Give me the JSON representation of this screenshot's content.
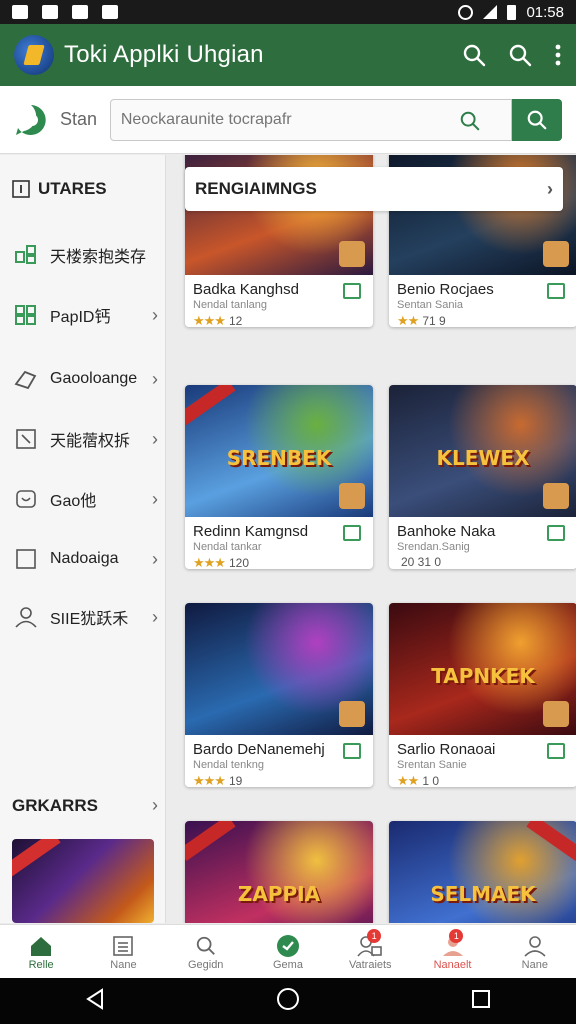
{
  "status_bar": {
    "time": "01:58"
  },
  "app_bar": {
    "title": "Toki Applki Uhgian"
  },
  "search": {
    "label": "Stan",
    "placeholder": "Neockaraunite tocrapafr"
  },
  "sidebar": {
    "header": "UTARES",
    "items": [
      {
        "label": "天楼索抱类存",
        "icon": "grid-icon"
      },
      {
        "label": "PapID钙",
        "icon": "apps-icon"
      },
      {
        "label": "Gaooloange",
        "icon": "gamepad-icon"
      },
      {
        "label": "天能蓿权拆",
        "icon": "frame-icon"
      },
      {
        "label": "Gao他",
        "icon": "controller-icon"
      },
      {
        "label": "Nadoaiga",
        "icon": "tablet-icon"
      },
      {
        "label": "SIIE犹跃禾",
        "icon": "user-icon"
      }
    ],
    "sub_header": "GRKARRS"
  },
  "panel": {
    "section_title": "RENGIAIMNGS"
  },
  "games": [
    {
      "name": "Badka Kanghsd",
      "dev": "Nendal tanlang",
      "rating": "12",
      "stars": "★★★",
      "art_text": "",
      "colors": [
        "#2b1a40",
        "#c8562a",
        "#f2b23a"
      ]
    },
    {
      "name": "Benio Rocjaes",
      "dev": "Sentan Sania",
      "rating": "71 9",
      "stars": "★★",
      "art_text": "",
      "colors": [
        "#0c1424",
        "#24405e",
        "#d87a2a"
      ]
    },
    {
      "name": "Redinn Kamgnsd",
      "dev": "Nendal tankar",
      "rating": "120",
      "stars": "★★★",
      "art_text": "SRENBEK",
      "colors": [
        "#1a3a7a",
        "#5aa0e0",
        "#6ab040"
      ]
    },
    {
      "name": "Banhoke Naka",
      "dev": "Srendan.Sanig",
      "rating": "20 31 0",
      "stars": "",
      "art_text": "KLEWEX",
      "colors": [
        "#1b2238",
        "#3a4e7a",
        "#c86a30"
      ]
    },
    {
      "name": "Bardo DeNanemehj",
      "dev": "Nendal tenkng",
      "rating": "19",
      "stars": "★★★",
      "art_text": "",
      "colors": [
        "#101a40",
        "#2a6ab0",
        "#b040c0"
      ]
    },
    {
      "name": "Sarlio Ronaoai",
      "dev": "Srentan Sanie",
      "rating": "1 0",
      "stars": "★★",
      "art_text": "TAPNKEK",
      "colors": [
        "#3a0a10",
        "#a8281c",
        "#f0a030"
      ]
    },
    {
      "name": "",
      "dev": "",
      "rating": "",
      "stars": "",
      "art_text": "ZAPPIA",
      "colors": [
        "#3a1050",
        "#c03060",
        "#f0c040"
      ]
    },
    {
      "name": "",
      "dev": "",
      "rating": "",
      "stars": "",
      "art_text": "SELMAEK",
      "colors": [
        "#1a2a70",
        "#4070d0",
        "#e0a030"
      ]
    }
  ],
  "bottom_nav": [
    {
      "label": "Relle",
      "icon": "home-icon",
      "state": "active",
      "badge": ""
    },
    {
      "label": "Nane",
      "icon": "list-icon",
      "state": "",
      "badge": ""
    },
    {
      "label": "Gegidn",
      "icon": "search-icon",
      "state": "",
      "badge": ""
    },
    {
      "label": "Gema",
      "icon": "game-icon",
      "state": "",
      "badge": ""
    },
    {
      "label": "Vatraiets",
      "icon": "people-icon",
      "state": "",
      "badge": "1"
    },
    {
      "label": "Nanaelt",
      "icon": "account-alert-icon",
      "state": "alert",
      "badge": "1"
    },
    {
      "label": "Nane",
      "icon": "profile-icon",
      "state": "",
      "badge": ""
    }
  ],
  "colors": {
    "primary": "#2e6e3e",
    "accent": "#2e7d4a",
    "badge": "#e53935"
  }
}
